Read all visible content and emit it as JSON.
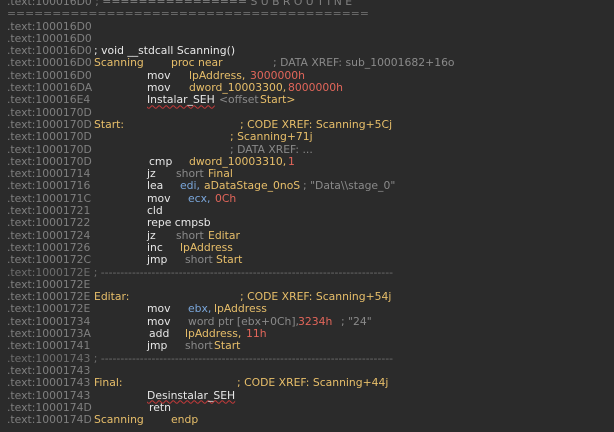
{
  "lines": [
    {
      "addr": ".text:100016D0 ; ================ S U B R O U T I N E"
    },
    {
      "addr": "========================================"
    },
    {
      "addr": ".text:100016D0"
    },
    {
      "addr": ".text:100016D0"
    },
    {
      "addr": ".text:100016D0",
      "text": "; void __stdcall Scanning()"
    },
    {
      "addr": ".text:100016D0",
      "label": "Scanning",
      "mn": "proc near",
      "comment": "; DATA XREF: sub_10001682+16o"
    },
    {
      "addr": ".text:100016D0",
      "mn": "mov",
      "op1": "lpAddress,",
      "op2": "3000000h"
    },
    {
      "addr": ".text:100016DA",
      "mn": "mov",
      "op1": "dword_10003300,",
      "op2": "8000000h"
    },
    {
      "addr": ".text:100016E4",
      "mn": "Instalar_SEH",
      "op1": "<offset",
      "op2": "Start>"
    },
    {
      "addr": ".text:1000170D"
    },
    {
      "addr": ".text:1000170D",
      "label": "Start:",
      "comment": "; CODE XREF: Scanning+5Cj"
    },
    {
      "addr": ".text:1000170D",
      "comment": "; Scanning+71j"
    },
    {
      "addr": ".text:1000170D",
      "comment": "; DATA XREF: ..."
    },
    {
      "addr": ".text:1000170D",
      "mn": "cmp",
      "op1": "dword_10003310,",
      "op2": "1"
    },
    {
      "addr": ".text:10001714",
      "mn": "jz",
      "op1": "short",
      "op2": "Final"
    },
    {
      "addr": ".text:10001716",
      "mn": "lea",
      "op1": "edi,",
      "op2": "aDataStage_0noS",
      "comment": "; \"Data\\\\stage_0\""
    },
    {
      "addr": ".text:1000171C",
      "mn": "mov",
      "op1": "ecx,",
      "op2": "0Ch"
    },
    {
      "addr": ".text:10001721",
      "mn": "cld"
    },
    {
      "addr": ".text:10001722",
      "mn": "repe cmpsb"
    },
    {
      "addr": ".text:10001724",
      "mn": "jz",
      "op1": "short",
      "op2": "Editar"
    },
    {
      "addr": ".text:10001726",
      "mn": "inc",
      "op1": "lpAddress"
    },
    {
      "addr": ".text:1000172C",
      "mn": "jmp",
      "op1": "short",
      "op2": "Start"
    },
    {
      "addr": ".text:1000172E ; ---------------------------------------------------------------------------"
    },
    {
      "addr": ".text:1000172E"
    },
    {
      "addr": ".text:1000172E",
      "label": "Editar:",
      "comment": "; CODE XREF: Scanning+54j"
    },
    {
      "addr": ".text:1000172E",
      "mn": "mov",
      "op1": "ebx,",
      "op2": "lpAddress"
    },
    {
      "addr": ".text:10001734",
      "mn": "mov",
      "op1": "word ptr [ebx+0Ch],",
      "op2": "3234h",
      "comment": "; \"24\""
    },
    {
      "addr": ".text:1000173A",
      "mn": "add",
      "op1": "lpAddress,",
      "op2": "11h"
    },
    {
      "addr": ".text:10001741",
      "mn": "jmp",
      "op1": "short",
      "op2": "Start"
    },
    {
      "addr": ".text:10001743 ; ---------------------------------------------------------------------------"
    },
    {
      "addr": ".text:10001743"
    },
    {
      "addr": ".text:10001743",
      "label": "Final:",
      "comment": "; CODE XREF: Scanning+44j"
    },
    {
      "addr": ".text:10001743",
      "mn": "Desinstalar_SEH"
    },
    {
      "addr": ".text:1000174D",
      "mn": "retn"
    },
    {
      "addr": ".text:1000174D",
      "label": "Scanning",
      "mn": "endp"
    }
  ],
  "colors": {
    "background": "#2b2b2b",
    "address": "#7f7f7f",
    "label": "#e8bf6a",
    "number": "#e2665a",
    "register": "#7aa6da",
    "comment": "#8a8a8a"
  }
}
